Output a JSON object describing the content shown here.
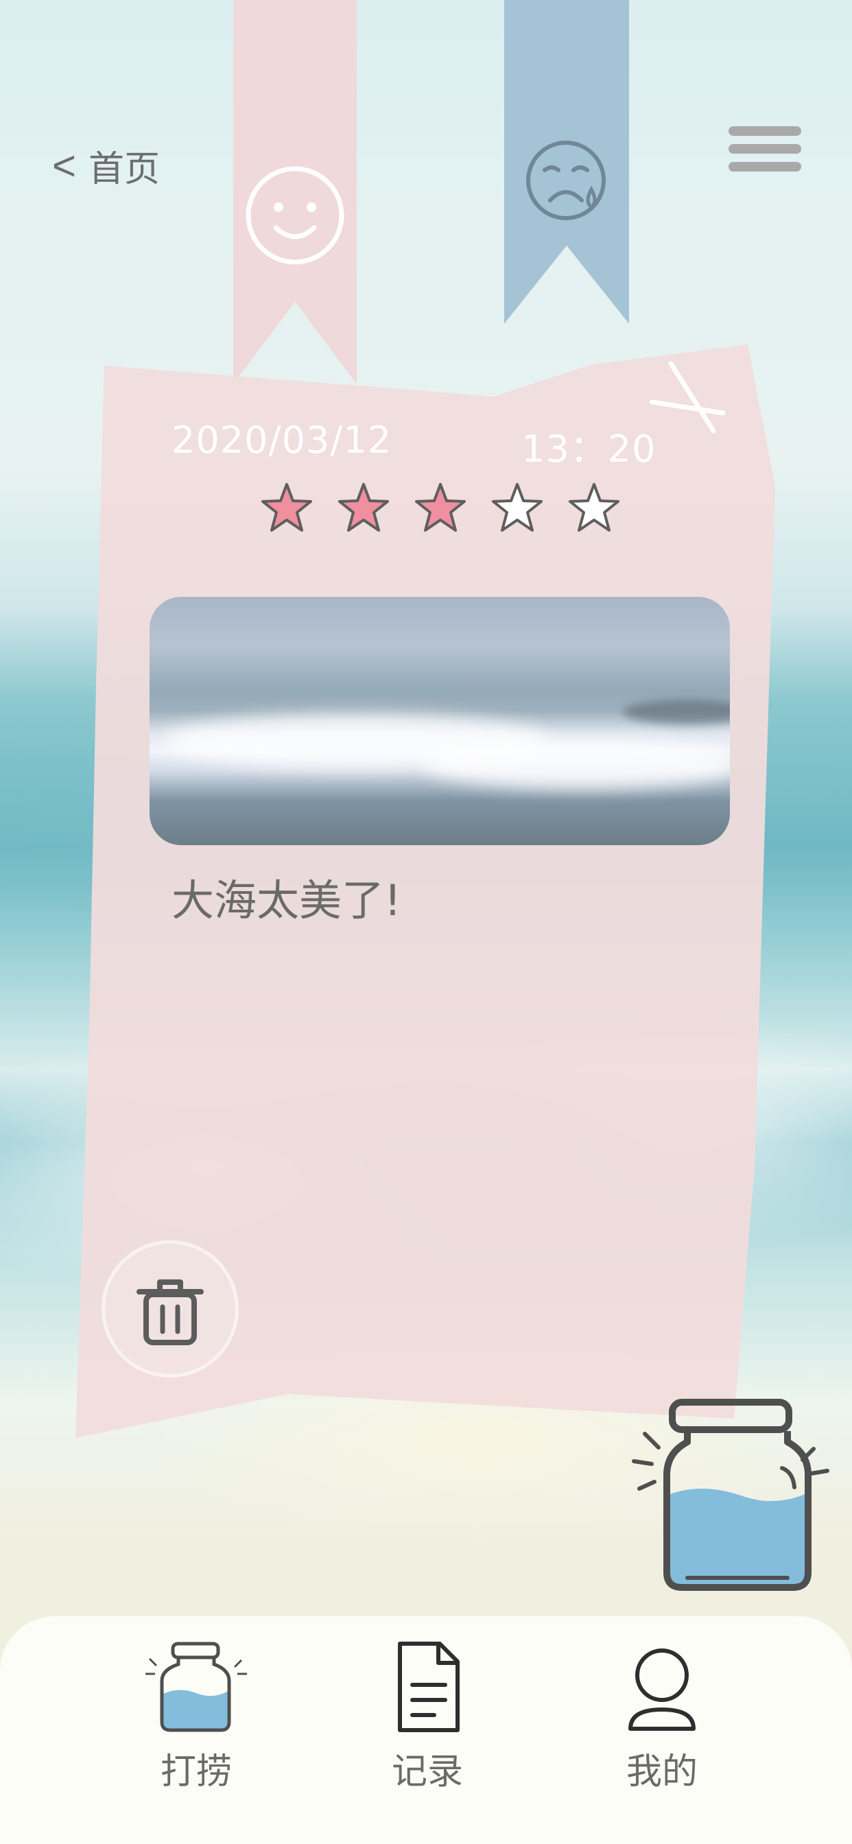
{
  "header": {
    "back_chevron": "<",
    "back_label": "首页",
    "menu_icon": "hamburger-menu-icon"
  },
  "ribbons": {
    "happy": {
      "icon": "smile-face-icon",
      "color": "#efd9da"
    },
    "sad": {
      "icon": "crying-face-icon",
      "color": "#a4c4d6"
    }
  },
  "card": {
    "date": "2020/03/12",
    "time": "13：20",
    "rating": 3,
    "rating_max": 5,
    "text": "大海太美了!",
    "background_color": "#f1dcdc",
    "star_filled_color": "#ef8f9f"
  },
  "tabbar": {
    "items": [
      {
        "label": "打捞",
        "icon": "jar-icon"
      },
      {
        "label": "记录",
        "icon": "document-icon"
      },
      {
        "label": "我的",
        "icon": "user-icon"
      }
    ]
  }
}
